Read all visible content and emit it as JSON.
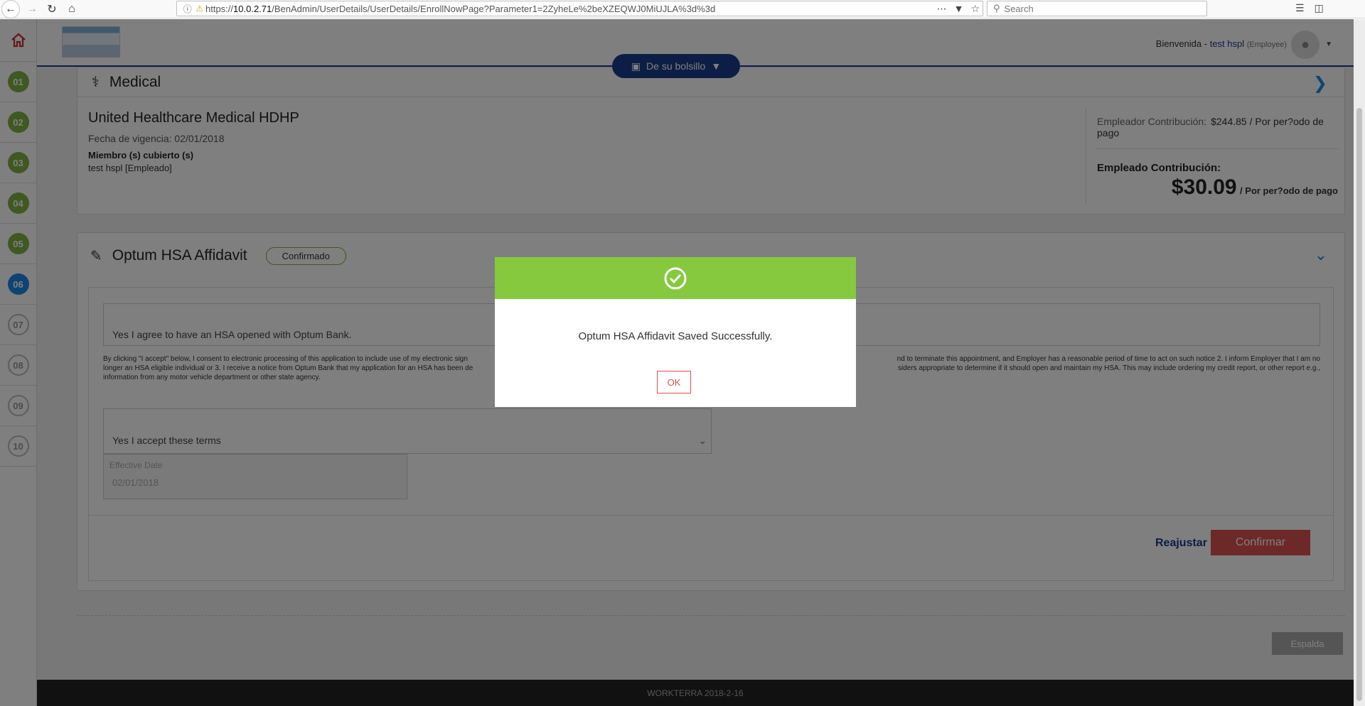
{
  "browser": {
    "url_prefix": "https://",
    "url_host": "10.0.2.71",
    "url_path": "/BenAdmin/UserDetails/UserDetails/EnrollNowPage?Parameter1=2ZyheLe%2beXZEQWJ0MiUJLA%3d%3d",
    "search_placeholder": "Search"
  },
  "sidebar": {
    "steps": [
      {
        "label": "01",
        "state": "done"
      },
      {
        "label": "02",
        "state": "done"
      },
      {
        "label": "03",
        "state": "done"
      },
      {
        "label": "04",
        "state": "done"
      },
      {
        "label": "05",
        "state": "done"
      },
      {
        "label": "06",
        "state": "current"
      },
      {
        "label": "07",
        "state": "pending"
      },
      {
        "label": "08",
        "state": "pending"
      },
      {
        "label": "09",
        "state": "pending"
      },
      {
        "label": "10",
        "state": "pending"
      }
    ]
  },
  "header": {
    "welcome": "Bienvenida -",
    "user_name": "test hspl",
    "user_role": "(Employee)",
    "pocket_button": "De su bolsillo"
  },
  "medical": {
    "title": "Medical",
    "plan_name": "United Healthcare Medical HDHP",
    "effective_date": "Fecha de vigencia: 02/01/2018",
    "members_label": "Miembro (s) cubierto (s)",
    "members": "test hspl [Empleado]",
    "employer_label": "Empleador Contribución:",
    "employer_value": "$244.85 / Por per?odo de pago",
    "employee_label": "Empleado Contribución:",
    "employee_amount": "$30.09",
    "employee_period": "/ Por per?odo de pago"
  },
  "hsa": {
    "title": "Optum HSA Affidavit",
    "status": "Confirmado",
    "agree_text": "Yes I agree to have an HSA opened with Optum Bank.",
    "legal_left": "By clicking \"I accept\" below, I consent to electronic processing of this application to include use of my electronic sign",
    "legal_right": "nd to terminate this appointment, and Employer has a reasonable period of time to act on such notice 2. I inform Employer that I am no",
    "legal_line2_left": "longer an HSA eligible individual or 3. I receive a notice from Optum Bank that my application for an HSA has been de",
    "legal_line2_right": "siders appropriate to determine if it should open and maintain my HSA. This may include ordering my credit report, or other report e.g.,",
    "legal_line3": "information from any motor vehicle department or other state agency.",
    "terms_select": "Yes I accept these terms",
    "date_label": "Effective Date",
    "date_value": "02/01/2018",
    "reset_button": "Reajustar",
    "confirm_button": "Confirmar"
  },
  "back_button": "Espalda",
  "footer": "WORKTERRA 2018-2-16",
  "modal": {
    "message": "Optum HSA Affidavit Saved Successfully.",
    "ok_button": "OK"
  },
  "colors": {
    "accent": "#1a3c8c",
    "success": "#86c93f",
    "danger": "#d9534f"
  }
}
